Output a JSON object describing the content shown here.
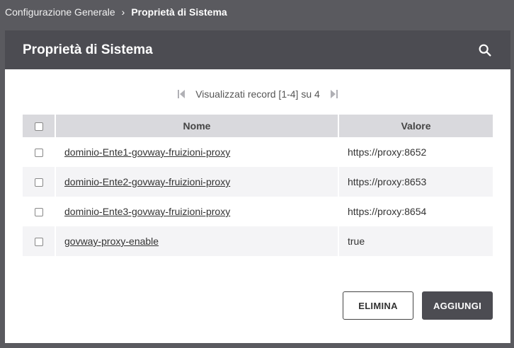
{
  "breadcrumb": {
    "parent": "Configurazione Generale",
    "separator": "›",
    "current": "Proprietà di Sistema"
  },
  "panel": {
    "title": "Proprietà di Sistema",
    "search_icon": "search-icon"
  },
  "pager": {
    "text": "Visualizzati record [1-4] su 4"
  },
  "table": {
    "headers": {
      "name": "Nome",
      "value": "Valore"
    },
    "rows": [
      {
        "name": "dominio-Ente1-govway-fruizioni-proxy",
        "value": "https://proxy:8652"
      },
      {
        "name": "dominio-Ente2-govway-fruizioni-proxy",
        "value": "https://proxy:8653"
      },
      {
        "name": "dominio-Ente3-govway-fruizioni-proxy",
        "value": "https://proxy:8654"
      },
      {
        "name": "govway-proxy-enable",
        "value": "true"
      }
    ]
  },
  "actions": {
    "delete_label": "ELIMINA",
    "add_label": "AGGIUNGI"
  }
}
